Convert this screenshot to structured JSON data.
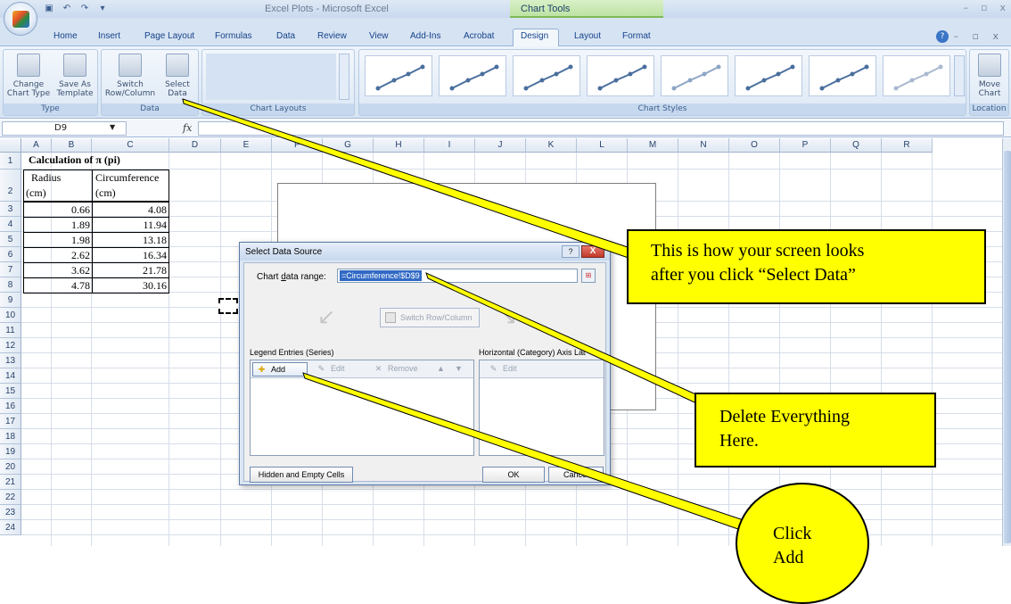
{
  "window": {
    "title": "Excel Plots - Microsoft Excel",
    "context_tab_group": "Chart Tools"
  },
  "tabs": [
    "Home",
    "Insert",
    "Page Layout",
    "Formulas",
    "Data",
    "Review",
    "View",
    "Add-Ins",
    "Acrobat",
    "Design",
    "Layout",
    "Format"
  ],
  "active_tab": "Design",
  "ribbon": {
    "type_group": {
      "label": "Type",
      "change_chart_type": "Change Chart Type",
      "save_as_template": "Save As Template"
    },
    "data_group": {
      "label": "Data",
      "switch_row_column": "Switch Row/Column",
      "select_data": "Select Data"
    },
    "layouts_group": {
      "label": "Chart Layouts"
    },
    "styles_group": {
      "label": "Chart Styles"
    },
    "location_group": {
      "label": "Location",
      "move_chart": "Move Chart"
    }
  },
  "formula_bar": {
    "name_box": "D9",
    "fx": "fx",
    "formula": ""
  },
  "columns": [
    "A",
    "B",
    "C",
    "D",
    "E",
    "F",
    "G",
    "H",
    "I",
    "J",
    "K",
    "L",
    "M",
    "N",
    "O",
    "P",
    "Q",
    "R"
  ],
  "rows": [
    "1",
    "2",
    "3",
    "4",
    "5",
    "6",
    "7",
    "8",
    "9",
    "10",
    "11",
    "12",
    "13",
    "14",
    "15",
    "16",
    "17",
    "18",
    "19",
    "20",
    "21",
    "22",
    "23",
    "24"
  ],
  "sheet": {
    "title_cell": "Calculation of π (pi)",
    "header_radius_1": "Radius",
    "header_radius_2": "(cm)",
    "header_circ_1": "Circumference",
    "header_circ_2": "(cm)",
    "data": [
      {
        "radius": "0.66",
        "circumference": "4.08"
      },
      {
        "radius": "1.89",
        "circumference": "11.94"
      },
      {
        "radius": "1.98",
        "circumference": "13.18"
      },
      {
        "radius": "2.62",
        "circumference": "16.34"
      },
      {
        "radius": "3.62",
        "circumference": "21.78"
      },
      {
        "radius": "4.78",
        "circumference": "30.16"
      }
    ]
  },
  "dialog": {
    "title": "Select Data Source",
    "help": "?",
    "close": "X",
    "range_label_pre": "Chart ",
    "range_label_key": "d",
    "range_label_post": "ata range:",
    "range_value": "=Circumference!$D$9",
    "switch_label": "Switch Row/Column",
    "legend_label": "Legend Entries (Series)",
    "axis_label": "Horizontal (Category) Axis Labels",
    "add": "Add",
    "edit": "Edit",
    "remove": "Remove",
    "axis_edit": "Edit",
    "hidden_cells": "Hidden and Empty Cells",
    "ok": "OK",
    "cancel": "Cancel"
  },
  "annotations": {
    "callout_1_line1": "This is how your screen looks",
    "callout_1_line2": "after you click “Select Data”",
    "callout_2_line1": "Delete Everything",
    "callout_2_line2": "Here.",
    "callout_3_line1": "Click",
    "callout_3_line2": "Add",
    "color": "#ffff00"
  },
  "icons": {
    "office_button": "office-logo-icon",
    "help": "help-icon",
    "range_picker": "collapse-dialog-icon",
    "move_up": "arrow-up-icon",
    "move_down": "arrow-down-icon"
  }
}
